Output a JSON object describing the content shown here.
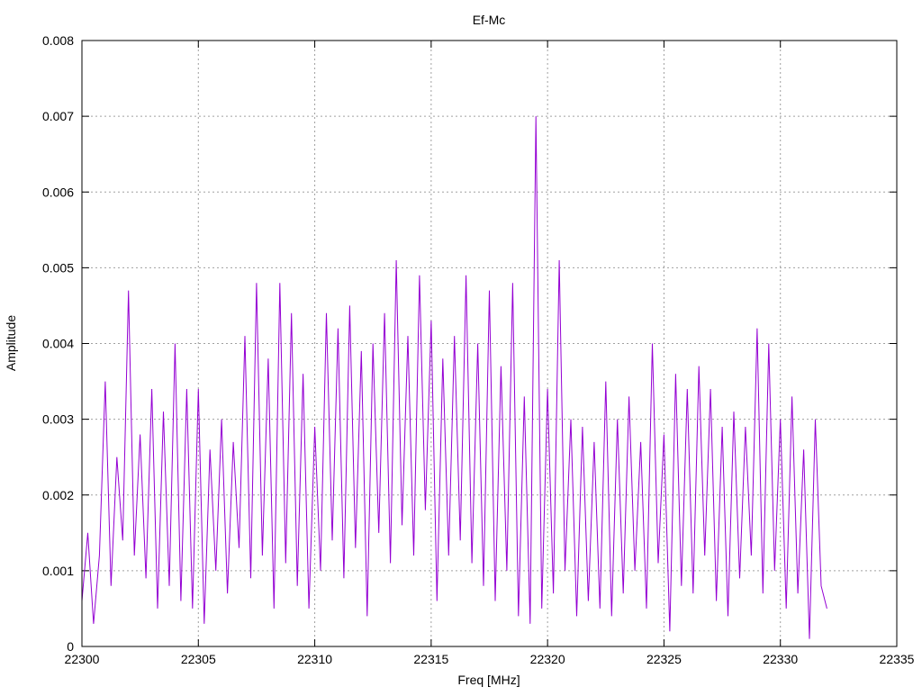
{
  "chart_data": {
    "type": "line",
    "title": "Ef-Mc",
    "xlabel": "Freq [MHz]",
    "ylabel": "Amplitude",
    "xlim": [
      22300,
      22335
    ],
    "ylim": [
      0,
      0.008
    ],
    "xticks": [
      "22300",
      "22305",
      "22310",
      "22315",
      "22320",
      "22325",
      "22330",
      "22335"
    ],
    "yticks": [
      "0",
      "0.001",
      "0.002",
      "0.003",
      "0.004",
      "0.005",
      "0.006",
      "0.007",
      "0.008"
    ],
    "grid": true,
    "legend": "none",
    "series": [
      {
        "name": "Ef-Mc",
        "color": "#9400d3",
        "x_start": 22300,
        "x_step": 0.25,
        "values": [
          0.0006,
          0.0015,
          0.0003,
          0.0012,
          0.0035,
          0.0008,
          0.0025,
          0.0014,
          0.0047,
          0.0012,
          0.0028,
          0.0009,
          0.0034,
          0.0005,
          0.0031,
          0.0008,
          0.004,
          0.0006,
          0.0034,
          0.0005,
          0.0034,
          0.0003,
          0.0026,
          0.001,
          0.003,
          0.0007,
          0.0027,
          0.0013,
          0.0041,
          0.0009,
          0.0048,
          0.0012,
          0.0038,
          0.0005,
          0.0048,
          0.0011,
          0.0044,
          0.0008,
          0.0036,
          0.0005,
          0.0029,
          0.001,
          0.0044,
          0.0014,
          0.0042,
          0.0009,
          0.0045,
          0.0013,
          0.0039,
          0.0004,
          0.004,
          0.0015,
          0.0044,
          0.0011,
          0.0051,
          0.0016,
          0.0041,
          0.0012,
          0.0049,
          0.0018,
          0.0043,
          0.0006,
          0.0038,
          0.0012,
          0.0041,
          0.0014,
          0.0049,
          0.0011,
          0.004,
          0.0008,
          0.0047,
          0.0006,
          0.0037,
          0.001,
          0.0048,
          0.0004,
          0.0033,
          0.0003,
          0.007,
          0.0005,
          0.0034,
          0.0007,
          0.0051,
          0.001,
          0.003,
          0.0004,
          0.0029,
          0.0006,
          0.0027,
          0.0005,
          0.0035,
          0.0004,
          0.003,
          0.0007,
          0.0033,
          0.001,
          0.0027,
          0.0005,
          0.004,
          0.0011,
          0.0028,
          0.0002,
          0.0036,
          0.0008,
          0.0034,
          0.0007,
          0.0037,
          0.0012,
          0.0034,
          0.0006,
          0.0029,
          0.0004,
          0.0031,
          0.0009,
          0.0029,
          0.0012,
          0.0042,
          0.0007,
          0.004,
          0.001,
          0.003,
          0.0005,
          0.0033,
          0.0007,
          0.0026,
          0.0001,
          0.003,
          0.0008,
          0.0005
        ]
      }
    ]
  }
}
